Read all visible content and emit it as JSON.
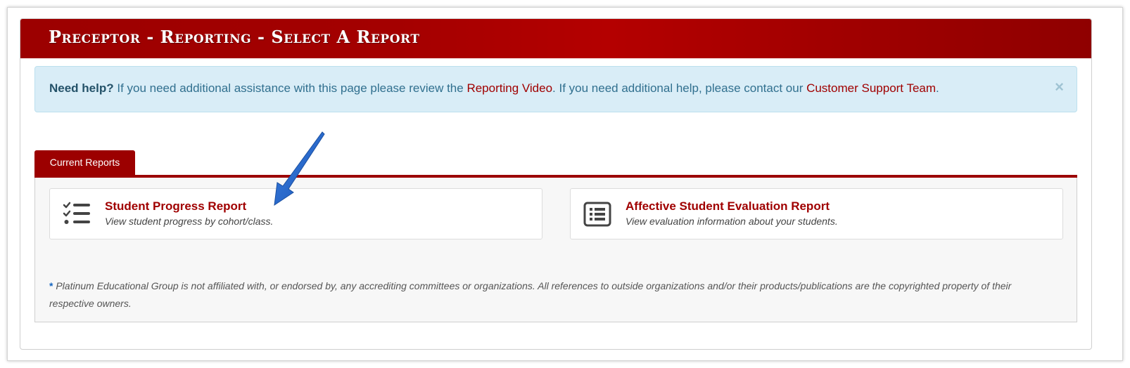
{
  "header": {
    "title": "Preceptor - Reporting - Select A Report"
  },
  "alert": {
    "lead": "Need help?",
    "text1": " If you need additional assistance with this page please review the ",
    "link1": "Reporting Video",
    "text2": ". If you need additional help, please contact our ",
    "link2": "Customer Support Team",
    "text3": ".",
    "close": "×"
  },
  "tabs": [
    {
      "label": "Current Reports",
      "active": true
    }
  ],
  "reports": [
    {
      "title": "Student Progress Report",
      "description": "View student progress by cohort/class.",
      "icon": "checklist-icon"
    },
    {
      "title": "Affective Student Evaluation Report",
      "description": "View evaluation information about your students.",
      "icon": "list-alt-icon"
    }
  ],
  "footnote": {
    "marker": "*",
    "text": " Platinum Educational Group is not affiliated with, or endorsed by, any accrediting committees or organizations. All references to outside organizations and/or their products/publications are the copyrighted property of their respective owners."
  },
  "annotation": {
    "type": "arrow",
    "color": "#1a5fc4"
  },
  "colors": {
    "brand": "#9c0000",
    "link": "#a00000",
    "alert_bg": "#d9edf7",
    "alert_text": "#31708f"
  }
}
